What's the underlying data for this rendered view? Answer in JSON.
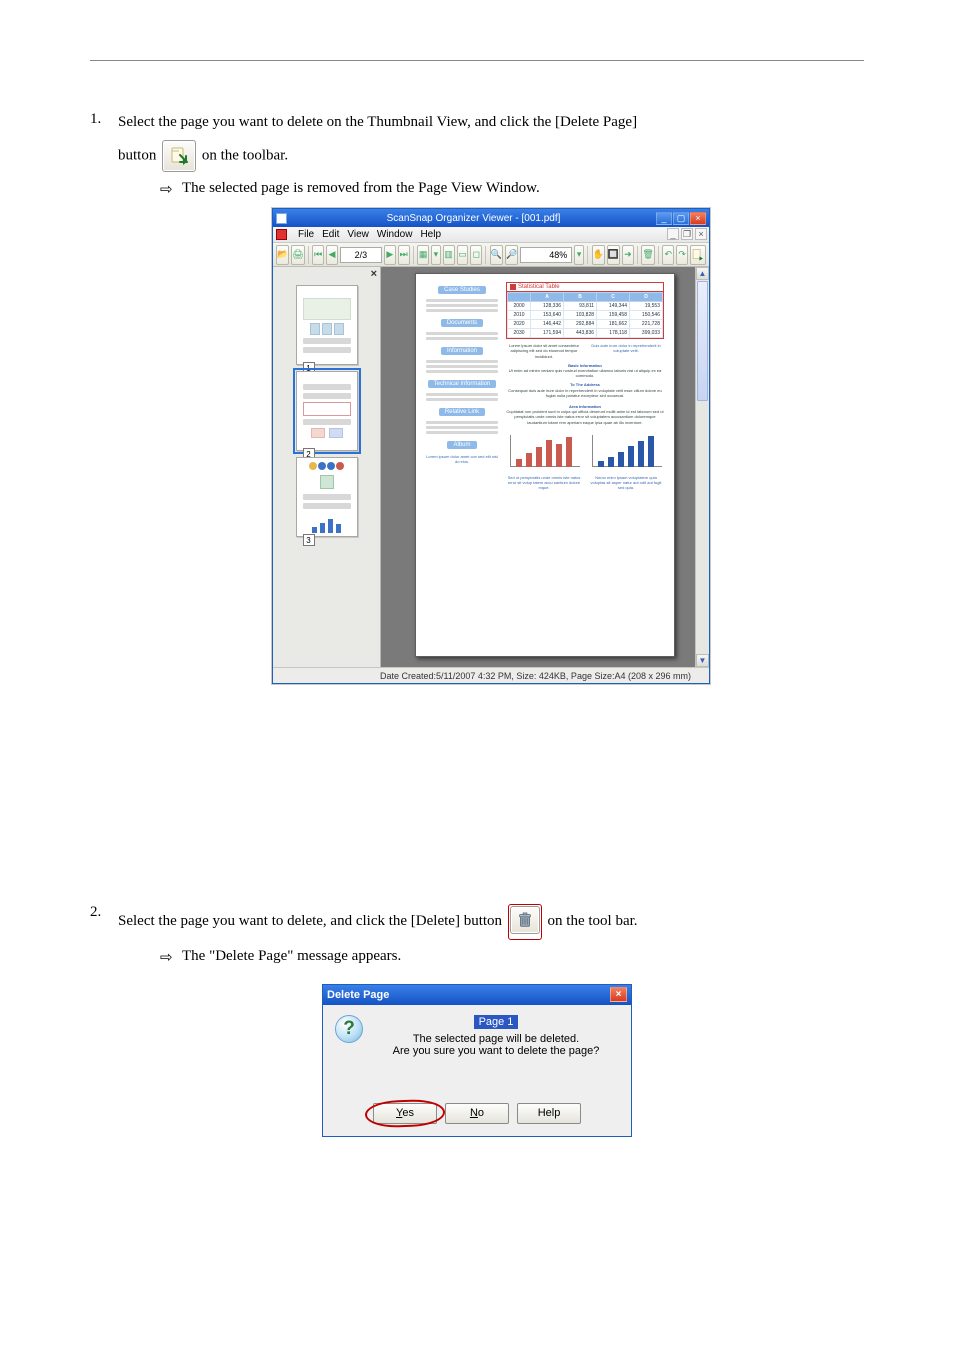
{
  "doc": {
    "step1_num": "1.",
    "step1_text_a": "Select the page you want to delete on the Thumbnail View, and click the [Delete Page]",
    "step1_text_b": "button",
    "step1_text_c": "on the toolbar.",
    "result1": "The selected page is removed from the Page View Window.",
    "step2_num": "2.",
    "step2_text_a": "Select the page you want to delete, and click the [Delete] button",
    "step2_text_b": "on the tool bar.",
    "result2": "The \"Delete Page\" message appears."
  },
  "icons": {
    "delete_page_btn_title": "Delete Page",
    "trash_btn_title": "Delete"
  },
  "appwin": {
    "title": "ScanSnap Organizer Viewer - [001.pdf]",
    "menus": [
      "File",
      "Edit",
      "View",
      "Window",
      "Help"
    ],
    "page_field": "2/3",
    "zoom_field": "48%",
    "status": "Date Created:5/11/2007 4:32 PM, Size: 424KB, Page Size:A4 (208 x 296 mm)",
    "thumbs": [
      "1",
      "2",
      "3"
    ],
    "page": {
      "sections": [
        "Case Studies",
        "Documents",
        "Information",
        "Technical Information",
        "Relative Link",
        "Album"
      ],
      "table_title": "Statistical Table",
      "table_headers": [
        "",
        "A",
        "B",
        "C",
        "D"
      ],
      "table_rows": [
        [
          "2000",
          "128,336",
          "93,811",
          "149,344",
          "19,553"
        ],
        [
          "2010",
          "153,640",
          "103,828",
          "159,458",
          "150,546"
        ],
        [
          "2020",
          "146,442",
          "292,884",
          "181,662",
          "221,728"
        ],
        [
          "2030",
          "171,594",
          "443,836",
          "178,118",
          "399,033"
        ]
      ]
    }
  },
  "dialog": {
    "title": "Delete Page",
    "page_label": "Page 1",
    "line1": "The selected page will be deleted.",
    "line2": "Are you sure you want to delete the page?",
    "yes": "Yes",
    "no": "No",
    "help": "Help"
  }
}
